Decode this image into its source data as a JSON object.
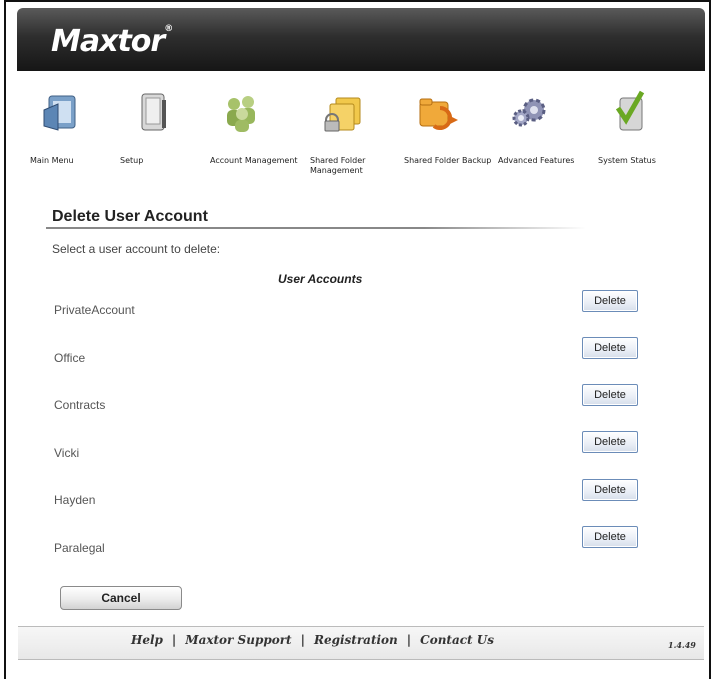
{
  "brand": {
    "logo_text": "Maxtor",
    "logo_mark": "®"
  },
  "nav": [
    {
      "label": "Main Menu",
      "icon": "main-menu-icon"
    },
    {
      "label": "Setup",
      "icon": "setup-icon"
    },
    {
      "label": "Account Management",
      "icon": "account-management-icon"
    },
    {
      "label": "Shared Folder Management",
      "icon": "shared-folder-management-icon"
    },
    {
      "label": "Shared Folder Backup",
      "icon": "shared-folder-backup-icon"
    },
    {
      "label": "Advanced Features",
      "icon": "advanced-features-icon"
    },
    {
      "label": "System Status",
      "icon": "system-status-icon"
    }
  ],
  "page": {
    "title": "Delete User Account",
    "subtitle": "Select a user account to delete:",
    "column_header": "User Accounts"
  },
  "accounts": [
    {
      "name": "PrivateAccount",
      "action": "Delete"
    },
    {
      "name": "Office",
      "action": "Delete"
    },
    {
      "name": "Contracts",
      "action": "Delete"
    },
    {
      "name": "Vicki",
      "action": "Delete"
    },
    {
      "name": "Hayden",
      "action": "Delete"
    },
    {
      "name": "Paralegal",
      "action": "Delete"
    }
  ],
  "cancel_label": "Cancel",
  "footer": {
    "links": [
      "Help",
      "Maxtor Support",
      "Registration",
      "Contact Us"
    ],
    "separator": "|",
    "version": "1.4.49"
  }
}
